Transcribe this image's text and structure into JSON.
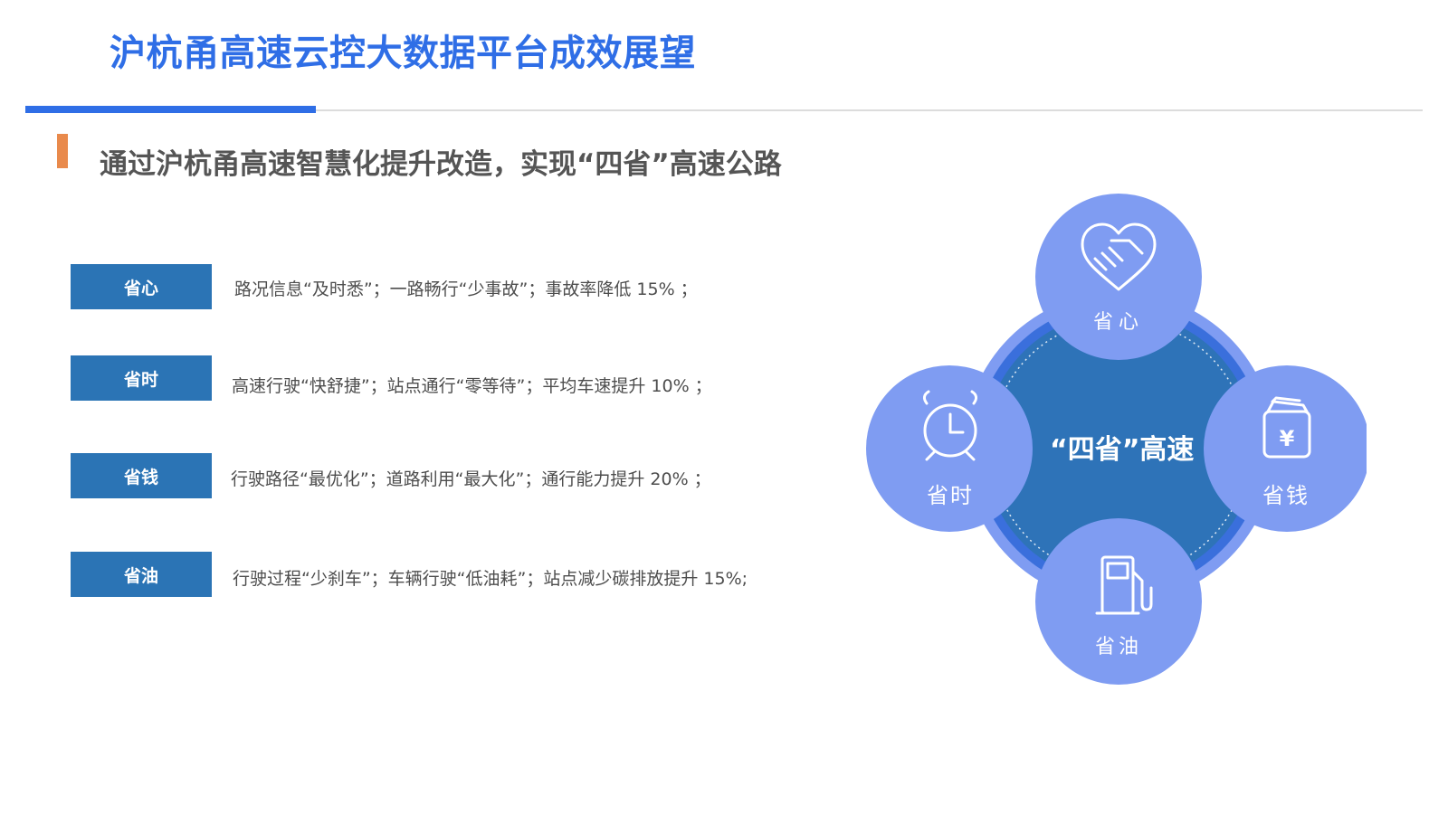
{
  "header": {
    "title": "沪杭甬高速云控大数据平台成效展望",
    "subtitle": "通过沪杭甬高速智慧化提升改造，实现“四省”高速公路"
  },
  "rows": [
    {
      "label": "省心",
      "text": "路况信息“及时悉”；一路畅行“少事故”；事故率降低 15% ；"
    },
    {
      "label": "省时",
      "text": "高速行驶“快舒捷”；站点通行“零等待”；平均车速提升 10% ；"
    },
    {
      "label": "省钱",
      "text": "行驶路径“最优化”；道路利用“最大化”；通行能力提升 20% ；"
    },
    {
      "label": "省油",
      "text": "行驶过程“少刹车”；车辆行驶“低油耗”；站点减少碳排放提升 15%;"
    }
  ],
  "diagram": {
    "center_text": "“四省”高速",
    "nodes": {
      "top": {
        "label": "省心",
        "icon": "handshake-heart-icon"
      },
      "left": {
        "label": "省时",
        "icon": "alarm-clock-icon"
      },
      "right": {
        "label": "省钱",
        "icon": "wallet-yen-icon"
      },
      "bottom": {
        "label": "省油",
        "icon": "fuel-pump-icon"
      }
    },
    "icon_yen_glyph": "¥"
  },
  "colors": {
    "title_blue": "#2f6ee6",
    "label_blue": "#2b74b5",
    "accent_orange": "#e98a4c",
    "center_blue": "#2e73b8",
    "node_periwinkle": "#7f9cf2"
  }
}
